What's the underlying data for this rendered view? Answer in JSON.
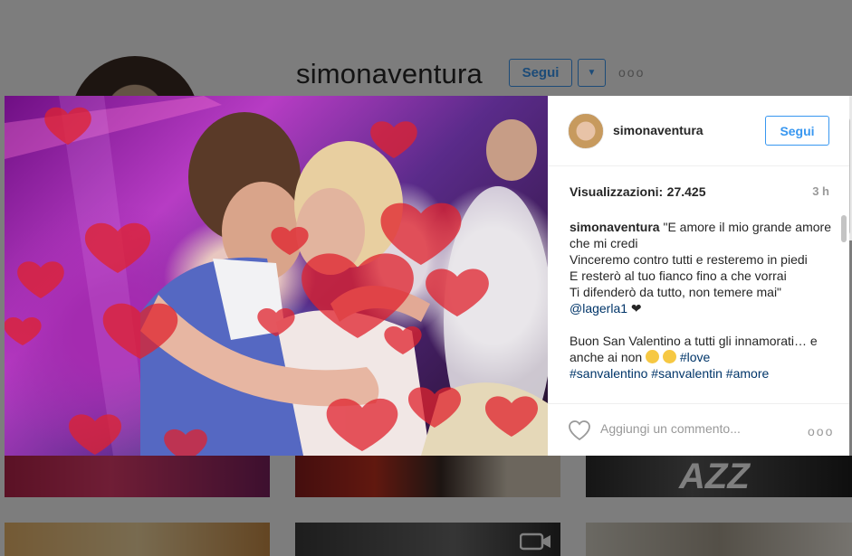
{
  "profile": {
    "username": "simonaventura",
    "follow_label": "Segui",
    "dropdown_icon": "chevron-down-icon",
    "more_icon": "ellipsis-icon",
    "more_glyph": "ooo"
  },
  "grid": {
    "thumb_text": "AZZ",
    "video_icon": "video-camera-icon"
  },
  "post": {
    "author": "simonaventura",
    "follow_label": "Segui",
    "views_label": "Visualizzazioni:",
    "views_count": "27.425",
    "time_ago": "3 h",
    "caption": {
      "user": "simonaventura",
      "lines": [
        "\"E amore il mio grande amore che mi credi",
        "Vinceremo contro tutti e resteremo in piedi",
        "E resterò al tuo fianco fino a che vorrai",
        "Ti difenderò da tutto, non temere mai\""
      ],
      "mention": "@lagerla1",
      "mention_suffix": " ❤",
      "line2_start": "Buon San Valentino a tutti gli innamorati… e anche ai non ",
      "hashtag_love": "#love",
      "hashtags": "#sanvalentino #sanvalentin #amore"
    },
    "comment_placeholder": "Aggiungi un commento...",
    "like_icon": "heart-outline-icon",
    "options_icon": "ellipsis-icon",
    "options_glyph": "ooo"
  },
  "colors": {
    "accent": "#3897f0",
    "text": "#262626",
    "muted": "#999999",
    "link": "#003569"
  }
}
